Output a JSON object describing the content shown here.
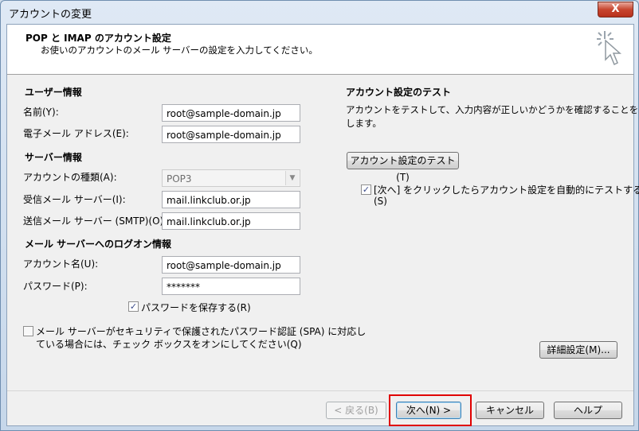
{
  "window": {
    "title": "アカウントの変更",
    "close_glyph": "X"
  },
  "header": {
    "title": "POP と IMAP のアカウント設定",
    "subtitle": "お使いのアカウントのメール サーバーの設定を入力してください。",
    "icon": "wizard-sparkle-cursor-icon"
  },
  "user_info": {
    "section_label": "ユーザー情報",
    "name_label": "名前(Y):",
    "name_value": "root@sample-domain.jp",
    "email_label": "電子メール アドレス(E):",
    "email_value": "root@sample-domain.jp"
  },
  "server_info": {
    "section_label": "サーバー情報",
    "account_type_label": "アカウントの種類(A):",
    "account_type_value": "POP3",
    "incoming_label": "受信メール サーバー(I):",
    "incoming_value": "mail.linkclub.or.jp",
    "outgoing_label": "送信メール サーバー (SMTP)(O):",
    "outgoing_value": "mail.linkclub.or.jp"
  },
  "logon_info": {
    "section_label": "メール サーバーへのログオン情報",
    "account_name_label": "アカウント名(U):",
    "account_name_value": "root@sample-domain.jp",
    "password_label": "パスワード(P):",
    "password_value": "*******",
    "save_password_label": "パスワードを保存する(R)",
    "save_password_checked": true,
    "spa_label_line1": "メール サーバーがセキュリティで保護されたパスワード認証 (SPA) に対応し",
    "spa_label_line2": "ている場合には、チェック ボックスをオンにしてください(Q)",
    "spa_checked": false
  },
  "test": {
    "section_label": "アカウント設定のテスト",
    "description_line1": "アカウントをテストして、入力内容が正しいかどうかを確認することをお勧め",
    "description_line2": "します。",
    "test_button": "アカウント設定のテスト(T)",
    "auto_test_label_line1": "[次へ] をクリックしたらアカウント設定を自動的にテストする",
    "auto_test_label_line2": "(S)",
    "auto_test_checked": true,
    "check_glyph": "✓"
  },
  "buttons": {
    "more_settings": "詳細設定(M)...",
    "back": "< 戻る(B)",
    "next": "次へ(N) >",
    "cancel": "キャンセル",
    "help": "ヘルプ"
  },
  "colors": {
    "highlight": "#e00000"
  }
}
